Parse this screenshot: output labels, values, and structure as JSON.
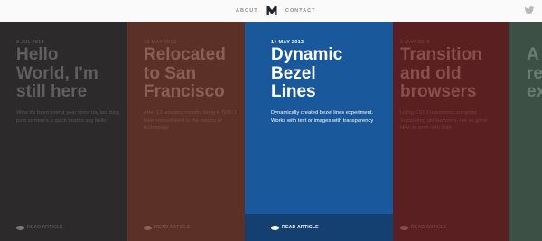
{
  "nav": {
    "about": "ABOUT",
    "contact": "CONTACT",
    "logo_icon": "m-logo-icon",
    "social_icon": "twitter-icon"
  },
  "colors": {
    "panel1": "#2d2a2b",
    "panel2": "#5b3026",
    "panel3": "#19589b",
    "panel4": "#5a1f20",
    "panel5": "#3d5046",
    "active_readbar": "#134070"
  },
  "posts": [
    {
      "date": "3 JUL 2014",
      "title": [
        "Hello",
        "World, I'm",
        "still here"
      ],
      "excerpt": "Wow it's been over a year since my last blog post so here's a quick post to say hello",
      "read": "READ ARTICLE"
    },
    {
      "date": "23 MAY 2013",
      "title": [
        "Relocated",
        "to San",
        "Francisco"
      ],
      "excerpt": "After 13 amazing months living in NYC I have moved west to the mecca of technology",
      "read": "READ ARTICLE"
    },
    {
      "date": "14 MAY 2013",
      "title": [
        "Dynamic",
        "Bezel",
        "Lines"
      ],
      "excerpt": "Dynamically created bezel lines experiment. Works with text or images with transparency",
      "read": "READ ARTICLE"
    },
    {
      "date": "2 MAY 2013",
      "title": [
        "Transition",
        "and old",
        "browsers"
      ],
      "excerpt": "Using CSS3 transitions are great. Supporting old browsers, not as great. How to work with both",
      "read": "READ ARTICLE"
    },
    {
      "date": "",
      "title": [
        "A",
        "re",
        "ex"
      ],
      "excerpt": "",
      "read": ""
    }
  ]
}
